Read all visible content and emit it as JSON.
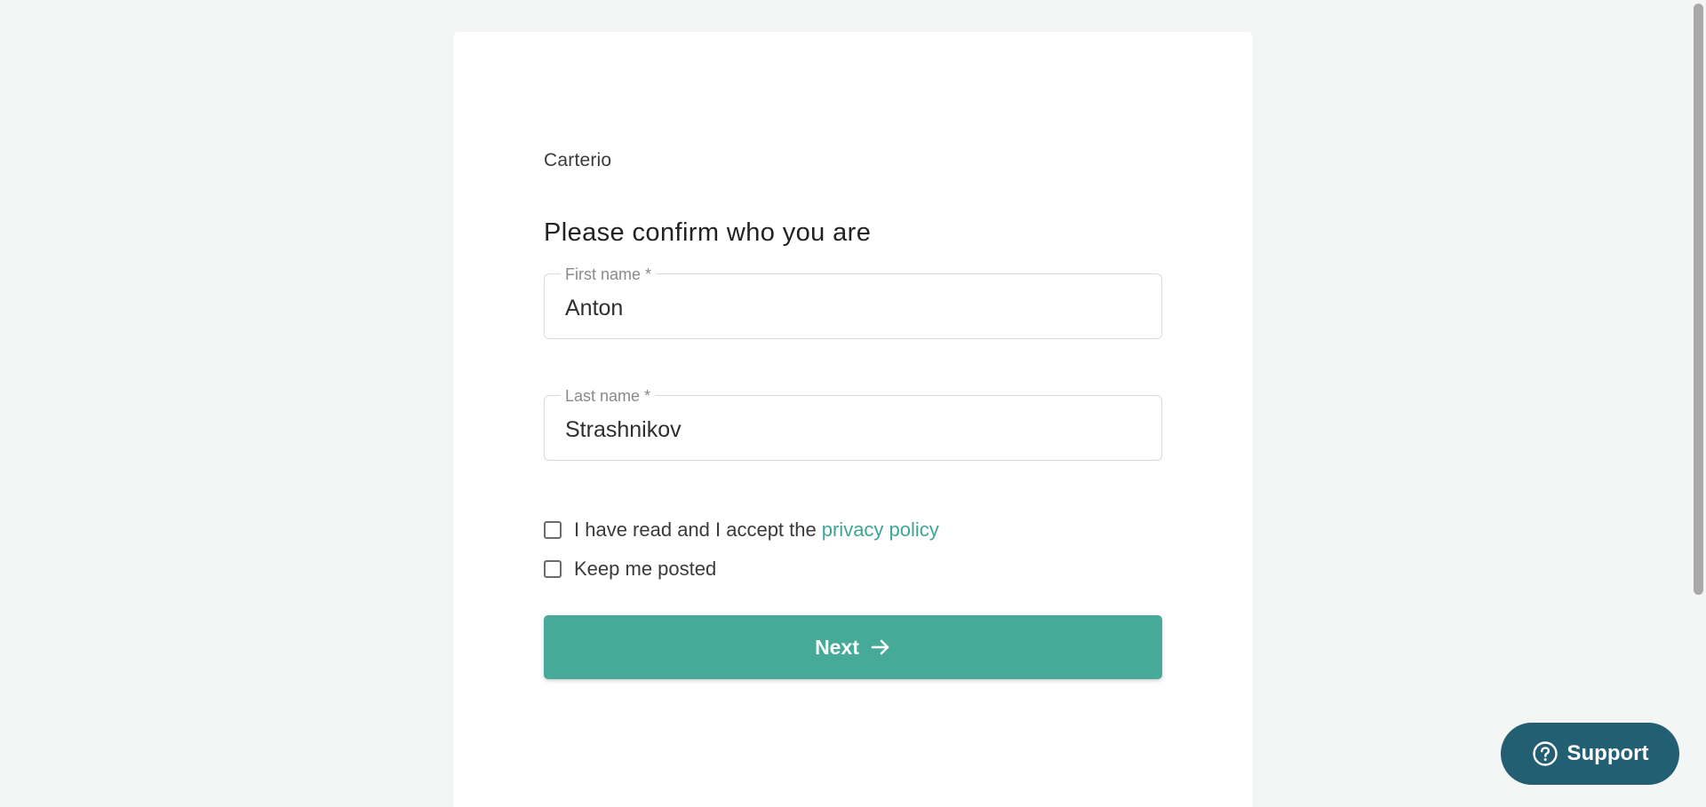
{
  "app": {
    "brand": "Carterio"
  },
  "form": {
    "heading": "Please confirm who you are",
    "first_name": {
      "label": "First name *",
      "value": "Anton"
    },
    "last_name": {
      "label": "Last name *",
      "value": "Strashnikov"
    },
    "privacy": {
      "text": "I have read and I accept the",
      "link_text": "privacy policy",
      "checked": false
    },
    "keep_posted": {
      "text": "Keep me posted",
      "checked": false
    },
    "next_label": "Next",
    "next_icon": "arrow-right-icon"
  },
  "support": {
    "label": "Support",
    "icon": "help-circle-icon"
  },
  "colors": {
    "accent": "#47aa98",
    "link": "#3ea597",
    "support_bg": "#235f73",
    "page_bg": "#f4f6f5"
  }
}
